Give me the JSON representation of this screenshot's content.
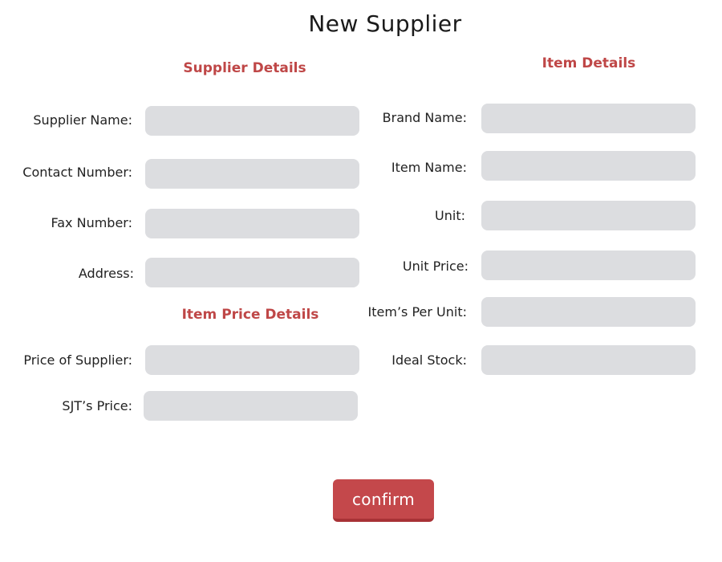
{
  "page": {
    "title": "New Supplier"
  },
  "supplier_details": {
    "heading": "Supplier Details",
    "fields": [
      {
        "label": "Supplier Name:",
        "value": "",
        "placeholder": ""
      },
      {
        "label": "Contact Number:",
        "value": "",
        "placeholder": ""
      },
      {
        "label": "Fax Number:",
        "value": "",
        "placeholder": ""
      },
      {
        "label": "Address:",
        "value": "",
        "placeholder": ""
      }
    ]
  },
  "item_price_details": {
    "heading": "Item Price Details",
    "fields": [
      {
        "label": "Price of Supplier:",
        "value": "",
        "placeholder": ""
      },
      {
        "label": "SJT’s Price:",
        "value": "",
        "placeholder": ""
      }
    ]
  },
  "item_details": {
    "heading": "Item Details",
    "fields": [
      {
        "label": "Brand Name:",
        "value": "",
        "placeholder": ""
      },
      {
        "label": "Item Name:",
        "value": "",
        "placeholder": ""
      },
      {
        "label": "Unit:",
        "value": "",
        "placeholder": ""
      },
      {
        "label": "Unit Price:",
        "value": "",
        "placeholder": ""
      },
      {
        "label": "Item’s Per Unit:",
        "value": "",
        "placeholder": ""
      },
      {
        "label": "Ideal Stock:",
        "value": "",
        "placeholder": ""
      }
    ]
  },
  "actions": {
    "confirm_label": "confirm"
  },
  "colors": {
    "accent": "#bf4747",
    "button": "#c4484b",
    "input_background": "#dcdde0",
    "text": "#222222"
  }
}
